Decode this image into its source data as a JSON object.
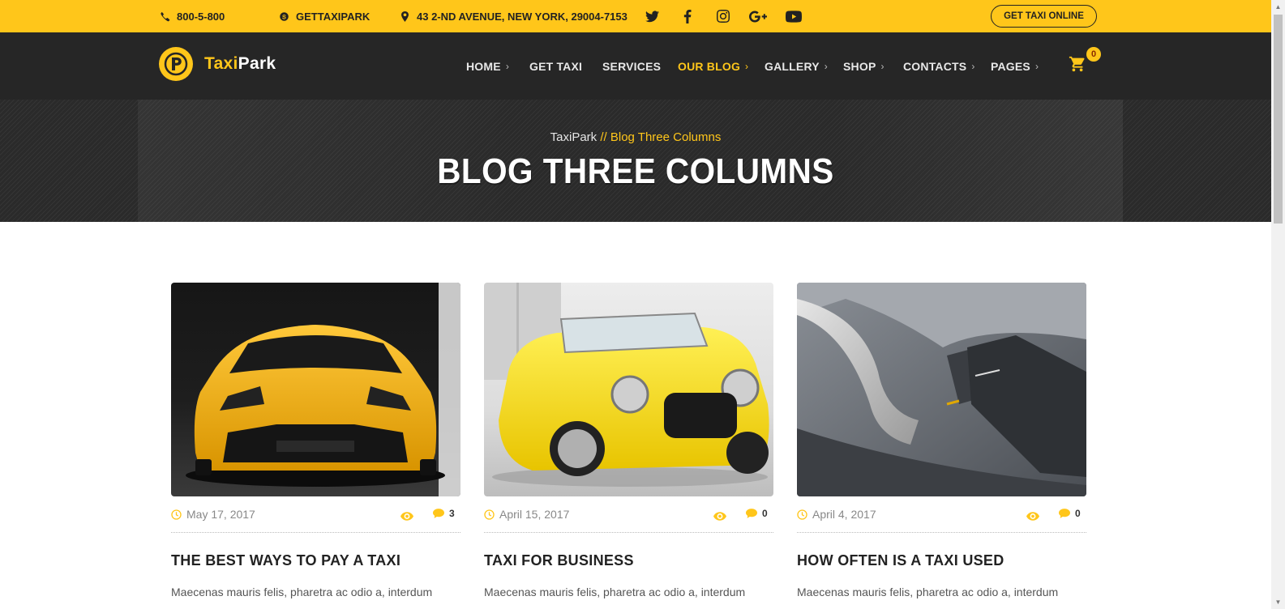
{
  "topbar": {
    "phone": "800-5-800",
    "skype": "GETTAXIPARK",
    "address": "43 2-ND AVENUE, NEW YORK, 29004-7153",
    "social_icons": [
      "twitter-icon",
      "facebook-icon",
      "instagram-icon",
      "google-plus-icon",
      "youtube-icon"
    ],
    "cta_label": "GET TAXI ONLINE"
  },
  "header": {
    "logo_letter": "P",
    "logo_part1": "Taxi",
    "logo_part2": "Park",
    "nav": [
      {
        "label": "HOME",
        "has_submenu": true,
        "active": false
      },
      {
        "label": "GET TAXI",
        "has_submenu": false,
        "active": false
      },
      {
        "label": "SERVICES",
        "has_submenu": false,
        "active": false
      },
      {
        "label": "OUR BLOG",
        "has_submenu": true,
        "active": true
      },
      {
        "label": "GALLERY",
        "has_submenu": true,
        "active": false
      },
      {
        "label": "SHOP",
        "has_submenu": true,
        "active": false
      },
      {
        "label": "CONTACTS",
        "has_submenu": true,
        "active": false
      },
      {
        "label": "PAGES",
        "has_submenu": true,
        "active": false
      }
    ],
    "cart_count": "0"
  },
  "hero": {
    "breadcrumb_home": "TaxiPark",
    "breadcrumb_sep": "//",
    "breadcrumb_current": "Blog Three Columns",
    "title": "BLOG THREE COLUMNS"
  },
  "posts": [
    {
      "date": "May 17, 2017",
      "comments": "3",
      "title": "THE BEST WAYS TO PAY A TAXI",
      "excerpt": "Maecenas mauris felis, pharetra ac odio a, interdum",
      "image": "yellow-sports-car"
    },
    {
      "date": "April 15, 2017",
      "comments": "0",
      "title": "TAXI FOR BUSINESS",
      "excerpt": "Maecenas mauris felis, pharetra ac odio a, interdum",
      "image": "yellow-convertible-car"
    },
    {
      "date": "April 4, 2017",
      "comments": "0",
      "title": "HOW OFTEN IS A TAXI USED",
      "excerpt": "Maecenas mauris felis, pharetra ac odio a, interdum",
      "image": "car-door-interior"
    }
  ],
  "colors": {
    "accent": "#ffc61a",
    "header_bg": "#262626",
    "text_dark": "#222222"
  }
}
